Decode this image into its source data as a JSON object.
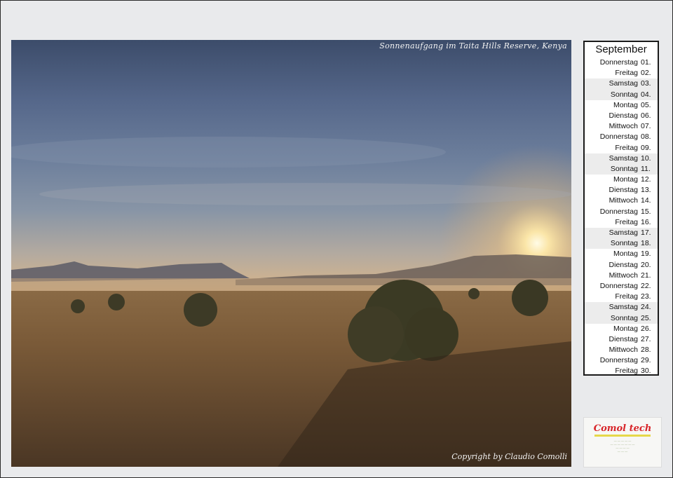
{
  "photo": {
    "caption": "Sonnenaufgang im Taita Hills Reserve, Kenya",
    "copyright": "Copyright by Claudio Comolli"
  },
  "calendar": {
    "month": "September",
    "days": [
      {
        "day": "Donnerstag",
        "num": "01."
      },
      {
        "day": "Freitag",
        "num": "02."
      },
      {
        "day": "Samstag",
        "num": "03."
      },
      {
        "day": "Sonntag",
        "num": "04."
      },
      {
        "day": "Montag",
        "num": "05."
      },
      {
        "day": "Dienstag",
        "num": "06."
      },
      {
        "day": "Mittwoch",
        "num": "07."
      },
      {
        "day": "Donnerstag",
        "num": "08."
      },
      {
        "day": "Freitag",
        "num": "09."
      },
      {
        "day": "Samstag",
        "num": "10."
      },
      {
        "day": "Sonntag",
        "num": "11."
      },
      {
        "day": "Montag",
        "num": "12."
      },
      {
        "day": "Dienstag",
        "num": "13."
      },
      {
        "day": "Mittwoch",
        "num": "14."
      },
      {
        "day": "Donnerstag",
        "num": "15."
      },
      {
        "day": "Freitag",
        "num": "16."
      },
      {
        "day": "Samstag",
        "num": "17."
      },
      {
        "day": "Sonntag",
        "num": "18."
      },
      {
        "day": "Montag",
        "num": "19."
      },
      {
        "day": "Dienstag",
        "num": "20."
      },
      {
        "day": "Mittwoch",
        "num": "21."
      },
      {
        "day": "Donnerstag",
        "num": "22."
      },
      {
        "day": "Freitag",
        "num": "23."
      },
      {
        "day": "Samstag",
        "num": "24."
      },
      {
        "day": "Sonntag",
        "num": "25."
      },
      {
        "day": "Montag",
        "num": "26."
      },
      {
        "day": "Dienstag",
        "num": "27."
      },
      {
        "day": "Mittwoch",
        "num": "28."
      },
      {
        "day": "Donnerstag",
        "num": "29."
      },
      {
        "day": "Freitag",
        "num": "30."
      }
    ]
  },
  "logo": {
    "name": "Comol tech"
  }
}
